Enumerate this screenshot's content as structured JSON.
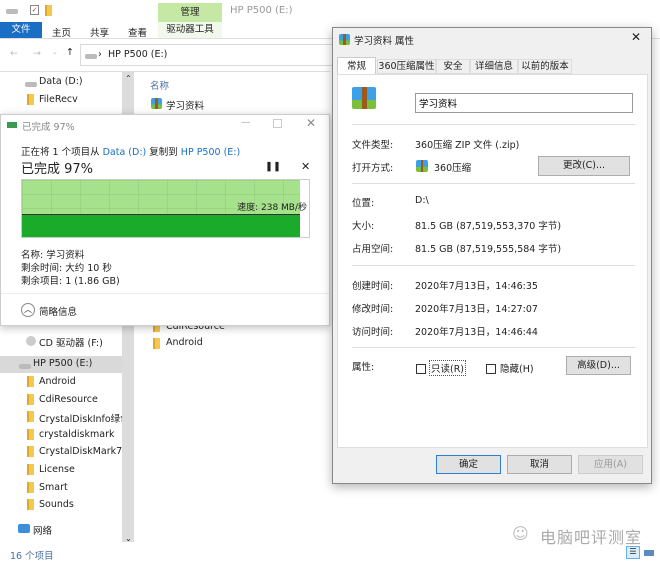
{
  "explorer": {
    "title": "HP P500 (E:)",
    "ribbon_context_tab": "管理",
    "ribbon_tabs": [
      "文件",
      "主页",
      "共享",
      "查看",
      "驱动器工具"
    ],
    "address": "HP P500 (E:)",
    "column_header": "名称",
    "nav_items_top": [
      "Data (D:)",
      "FileRecv"
    ],
    "nav_items_bottom": [
      "CD 驱动器 (F:)",
      "HP P500 (E:)",
      "Android",
      "CdiResource",
      "CrystalDiskInfo绿色版",
      "crystaldiskmark",
      "CrystalDiskMark7",
      "License",
      "Smart",
      "Sounds",
      "网络"
    ],
    "files_top": [
      "学习资料"
    ],
    "files_bottom": [
      "CdiResource",
      "Android"
    ],
    "status": "16 个项目"
  },
  "copy_dialog": {
    "title": "已完成 97%",
    "line_prefix": "正在将 1 个项目从 ",
    "source": "Data (D:)",
    "mid": " 复制到 ",
    "dest": "HP P500 (E:)",
    "progress_label": "已完成 97%",
    "progress_percent": 97,
    "speed": "速度: 238 MB/秒",
    "name": "名称: 学习资料",
    "time_left": "剩余时间: 大约 10 秒",
    "items_left": "剩余项目: 1 (1.86 GB)",
    "less_details": "简略信息",
    "link_color": "#1a6fc4"
  },
  "properties": {
    "title": "学习资料 属性",
    "tabs": [
      "常规",
      "360压缩属性",
      "安全",
      "详细信息",
      "以前的版本"
    ],
    "name_value": "学习资料",
    "rows": [
      {
        "label": "文件类型:",
        "value": "360压缩 ZIP 文件 (.zip)"
      },
      {
        "label": "打开方式:",
        "value": "360压缩"
      },
      {
        "label": "位置:",
        "value": "D:\\"
      },
      {
        "label": "大小:",
        "value": "81.5 GB (87,519,553,370 字节)"
      },
      {
        "label": "占用空间:",
        "value": "81.5 GB (87,519,555,584 字节)"
      },
      {
        "label": "创建时间:",
        "value": "2020年7月13日，14:46:35"
      },
      {
        "label": "修改时间:",
        "value": "2020年7月13日，14:27:07"
      },
      {
        "label": "访问时间:",
        "value": "2020年7月13日，14:46:44"
      }
    ],
    "change_button": "更改(C)...",
    "attributes_label": "属性:",
    "readonly": "只读(R)",
    "hidden": "隐藏(H)",
    "advanced_button": "高级(D)...",
    "ok": "确定",
    "cancel": "取消",
    "apply": "应用(A)"
  },
  "watermark": "电脑吧评测室"
}
